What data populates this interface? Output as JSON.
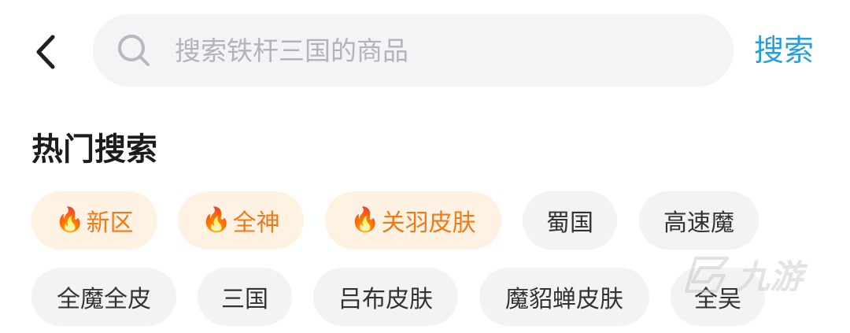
{
  "search": {
    "placeholder": "搜索铁杆三国的商品",
    "submit_label": "搜索"
  },
  "hot_search": {
    "title": "热门搜索",
    "tags": [
      {
        "label": "新区",
        "hot": true
      },
      {
        "label": "全神",
        "hot": true
      },
      {
        "label": "关羽皮肤",
        "hot": true
      },
      {
        "label": "蜀国",
        "hot": false
      },
      {
        "label": "高速魔",
        "hot": false
      },
      {
        "label": "全魔全皮",
        "hot": false
      },
      {
        "label": "三国",
        "hot": false
      },
      {
        "label": "吕布皮肤",
        "hot": false
      },
      {
        "label": "魔貂蝉皮肤",
        "hot": false
      },
      {
        "label": "全吴",
        "hot": false
      }
    ]
  },
  "watermark": {
    "text": "九游"
  },
  "colors": {
    "accent": "#2a9fd6",
    "hot_text": "#f07a16",
    "hot_bg": "#fff2e3",
    "tag_bg": "#f3f3f6"
  },
  "icons": {
    "back": "chevron-left-icon",
    "search": "search-icon",
    "fire": "fire-icon"
  }
}
